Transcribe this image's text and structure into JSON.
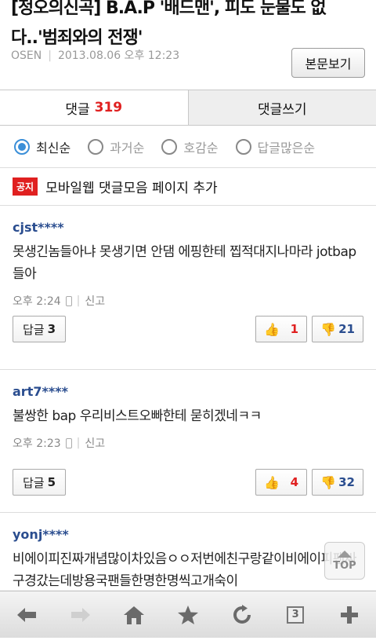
{
  "article": {
    "title": "[정오의신곡] B.A.P '배드맨', 피도 눈물도 없다..'범죄와의 전쟁'",
    "source": "OSEN",
    "datetime": "2013.08.06 오후 12:23",
    "view_button": "본문보기"
  },
  "tabs": {
    "comments_label": "댓글",
    "comments_count": "319",
    "write_label": "댓글쓰기"
  },
  "sort": {
    "options": [
      "최신순",
      "과거순",
      "호감순",
      "답글많은순"
    ],
    "selected": "최신순"
  },
  "notice": {
    "badge": "공지",
    "text": "모바일웹 댓글모음 페이지 추가"
  },
  "comments": [
    {
      "author": "cjst****",
      "body": "못생긴놈들아냐 못생기면 안댐 에핑한테 찝적대지나마라 jotbap 들아",
      "time": "오후 2:24",
      "report": "신고",
      "reply_label": "답글",
      "reply_count": "3",
      "likes": "1",
      "dislikes": "21"
    },
    {
      "author": "art7****",
      "body": "불쌍한 bap 우리비스트오빠한테 묻히겠네ㅋㅋ",
      "time": "오후 2:23",
      "report": "신고",
      "reply_label": "답글",
      "reply_count": "5",
      "likes": "4",
      "dislikes": "32"
    },
    {
      "author": "yonj****",
      "body": "비에이피진짜개념많이차있음ㅇㅇ저번에친구랑같이비에이피팬싸구경갔는데방용국팬들한명한명씩고개숙이"
    }
  ],
  "top_button": "TOP",
  "toolbar": {
    "tab_count": "3"
  }
}
